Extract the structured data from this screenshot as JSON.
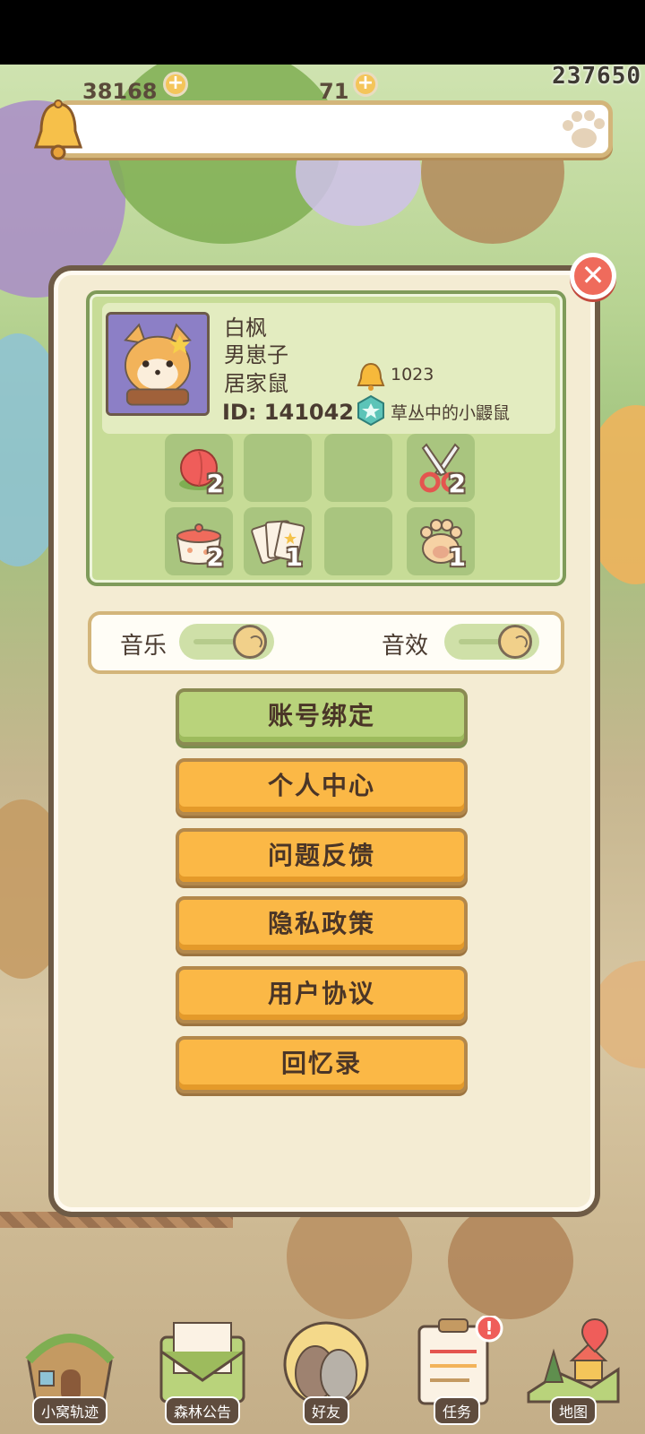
{
  "status_bar": {
    "score": "237650"
  },
  "hud": {
    "counter_a": "38168",
    "counter_b": "71"
  },
  "profile": {
    "name": "白枫",
    "gender": "男崽子",
    "role": "居家鼠",
    "id_text": "ID: 141042",
    "bell_count": "1023",
    "title": "草丛中的小鼹鼠"
  },
  "inventory": [
    {
      "icon": "peach-icon",
      "qty": "2"
    },
    {
      "icon": "empty-slot",
      "qty": ""
    },
    {
      "icon": "empty-slot",
      "qty": ""
    },
    {
      "icon": "scissors-icon",
      "qty": "2"
    },
    {
      "icon": "cooking-pot-icon",
      "qty": "2"
    },
    {
      "icon": "cards-icon",
      "qty": "1"
    },
    {
      "icon": "empty-slot",
      "qty": ""
    },
    {
      "icon": "paw-icon",
      "qty": "1"
    }
  ],
  "settings": {
    "music_label": "音乐",
    "sfx_label": "音效",
    "music_on": true,
    "sfx_on": true
  },
  "menu": {
    "bind_account": "账号绑定",
    "personal_center": "个人中心",
    "feedback": "问题反馈",
    "privacy": "隐私政策",
    "user_agreement": "用户协议",
    "memories": "回忆录"
  },
  "nav": {
    "nest_track": "小窝轨迹",
    "forest_notice": "森林公告",
    "friends": "好友",
    "tasks": "任务",
    "map": "地图"
  },
  "colors": {
    "panel_bg": "#f4ecd3",
    "orange_button": "#fbb846",
    "green_button": "#b9d37b",
    "profile_bg": "#c7dc97"
  }
}
